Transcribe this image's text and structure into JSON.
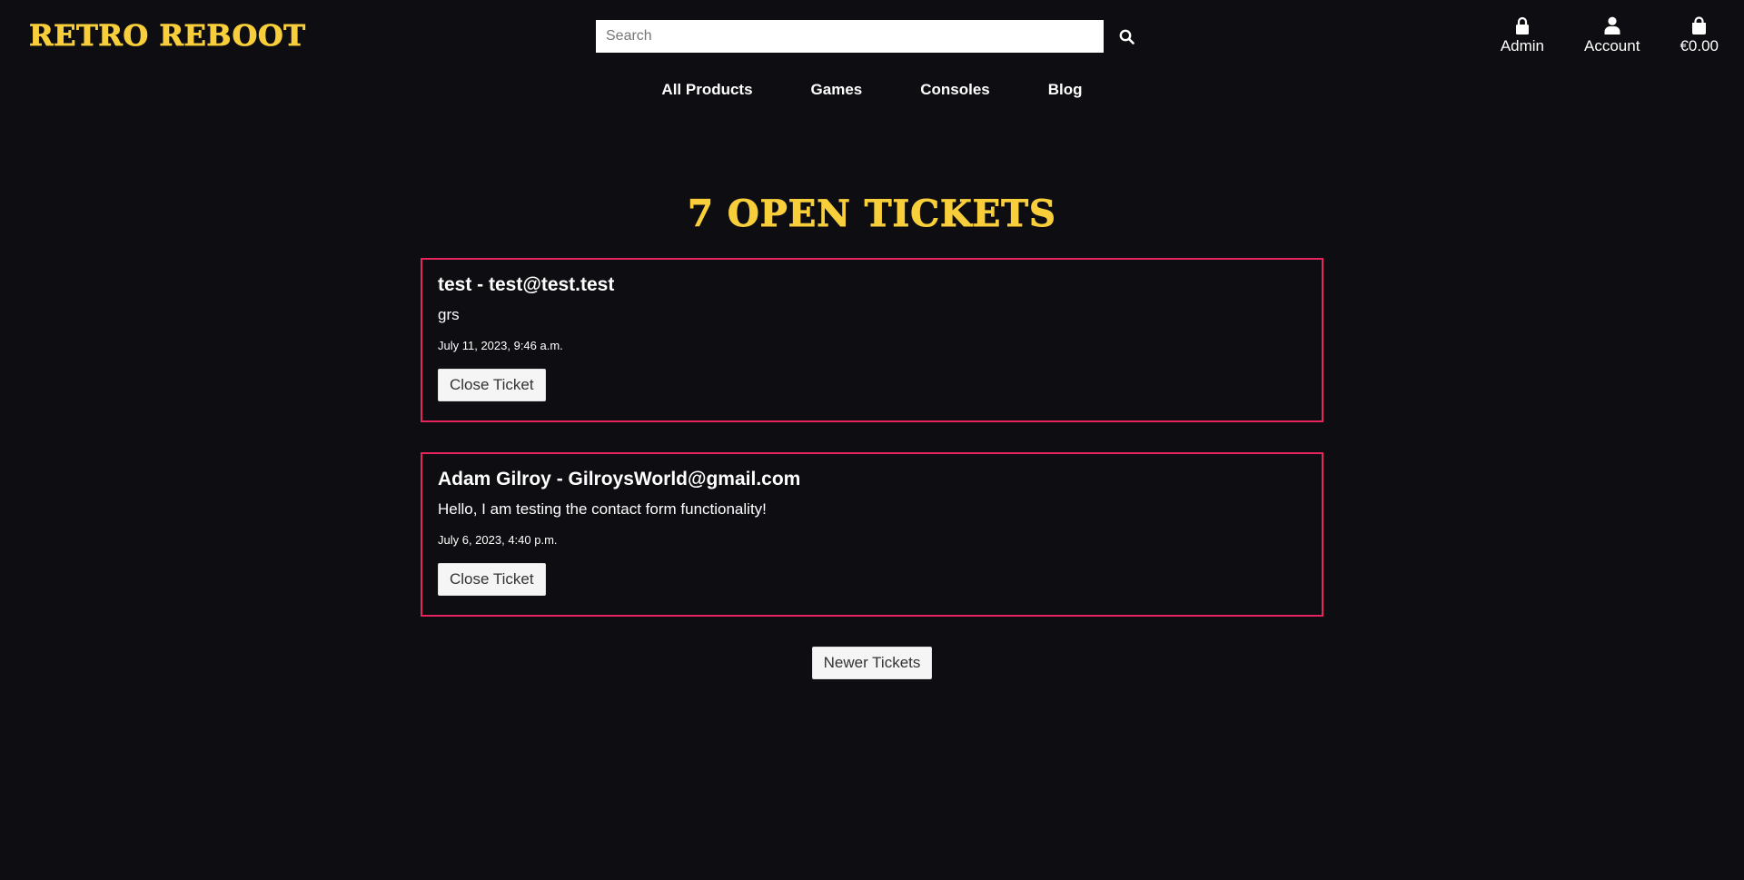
{
  "brand": {
    "logo_text": "RETRO REBOOT",
    "accent_color": "#f8cf3a",
    "ticket_border_color": "#e8245f",
    "background_color": "#0d0d12"
  },
  "search": {
    "placeholder": "Search",
    "value": "",
    "icon": "search-icon"
  },
  "header_actions": [
    {
      "label": "Admin",
      "icon": "lock-icon"
    },
    {
      "label": "Account",
      "icon": "user-icon"
    },
    {
      "label": "€0.00",
      "icon": "shopping-bag-icon"
    }
  ],
  "nav": [
    {
      "label": "All Products"
    },
    {
      "label": "Games"
    },
    {
      "label": "Consoles"
    },
    {
      "label": "Blog"
    }
  ],
  "main": {
    "title": "7 OPEN TICKETS",
    "tickets": [
      {
        "header": "test - test@test.test",
        "message": "grs",
        "date": "July 11, 2023, 9:46 a.m.",
        "close_label": "Close Ticket"
      },
      {
        "header": "Adam Gilroy - GilroysWorld@gmail.com",
        "message": "Hello, I am testing the contact form functionality!",
        "date": "July 6, 2023, 4:40 p.m.",
        "close_label": "Close Ticket"
      }
    ],
    "pagination": {
      "newer_label": "Newer Tickets"
    }
  }
}
